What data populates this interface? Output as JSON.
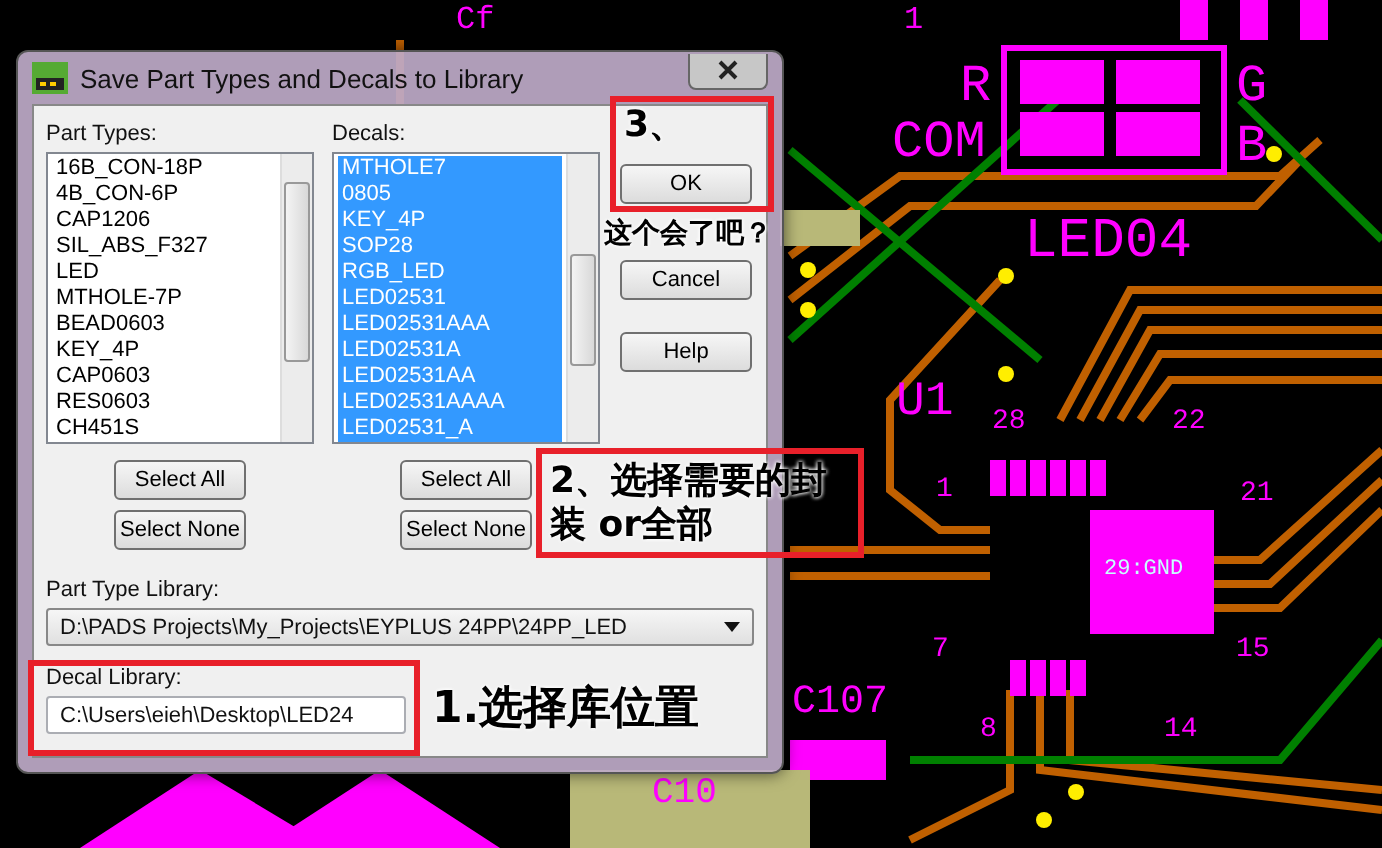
{
  "pcb": {
    "labels": [
      "Cf",
      "1",
      "R",
      "COM",
      "G",
      "B",
      "LED04",
      "U1",
      "28",
      "22",
      "21",
      "1",
      "29:GND",
      "7",
      "15",
      "8",
      "14",
      "C107",
      "C10"
    ]
  },
  "window": {
    "title": "Save Part Types and Decals to Library"
  },
  "part_types": {
    "label": "Part Types:",
    "items": [
      {
        "text": "16B_CON-18P",
        "selected": false
      },
      {
        "text": "4B_CON-6P",
        "selected": false
      },
      {
        "text": "CAP1206",
        "selected": false
      },
      {
        "text": "SIL_ABS_F327",
        "selected": false
      },
      {
        "text": "LED",
        "selected": false
      },
      {
        "text": "MTHOLE-7P",
        "selected": false
      },
      {
        "text": "BEAD0603",
        "selected": false
      },
      {
        "text": "KEY_4P",
        "selected": false
      },
      {
        "text": "CAP0603",
        "selected": false
      },
      {
        "text": "RES0603",
        "selected": false
      },
      {
        "text": "CH451S",
        "selected": false
      }
    ],
    "buttons": [
      "Select All",
      "Select None"
    ]
  },
  "decals": {
    "label": "Decals:",
    "items": [
      {
        "text": "MTHOLE7",
        "selected": true
      },
      {
        "text": "0805",
        "selected": true
      },
      {
        "text": "KEY_4P",
        "selected": true
      },
      {
        "text": "SOP28",
        "selected": true
      },
      {
        "text": "RGB_LED",
        "selected": true
      },
      {
        "text": "LED02531",
        "selected": true
      },
      {
        "text": "LED02531AAA",
        "selected": true
      },
      {
        "text": "LED02531A",
        "selected": true
      },
      {
        "text": "LED02531AA",
        "selected": true
      },
      {
        "text": "LED02531AAAA",
        "selected": true
      },
      {
        "text": "LED02531_A",
        "selected": true
      }
    ],
    "buttons": [
      "Select All",
      "Select None"
    ]
  },
  "side_buttons": [
    "OK",
    "Cancel",
    "Help"
  ],
  "part_type_library": {
    "label": "Part Type Library:",
    "value": "D:\\PADS Projects\\My_Projects\\EYPLUS 24PP\\24PP_LED"
  },
  "decal_library": {
    "label": "Decal Library:",
    "value": "C:\\Users\\eieh\\Desktop\\LED24"
  },
  "annotations": [
    "3、",
    "这个会了吧？",
    "2、选择需要的封装 or全部",
    "1.选择库位置"
  ]
}
